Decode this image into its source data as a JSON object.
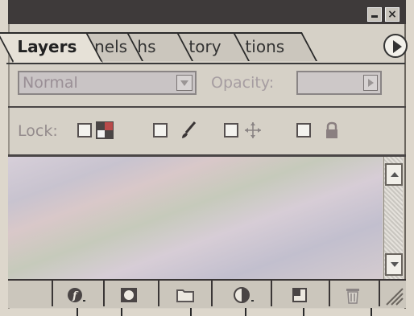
{
  "panel": {
    "tabs": [
      {
        "label": "Layers",
        "active": true
      },
      {
        "label": "nnels",
        "active": false
      },
      {
        "label": "hs",
        "active": false
      },
      {
        "label": "tory",
        "active": false
      },
      {
        "label": "tions",
        "active": false
      }
    ],
    "blend_mode": {
      "value": "Normal"
    },
    "opacity": {
      "label": "Opacity:",
      "value": ""
    },
    "lock": {
      "label": "Lock:",
      "options": [
        "lock-transparency",
        "lock-image",
        "lock-position",
        "lock-all"
      ]
    },
    "bottom_icons": [
      "layer-style-icon",
      "layer-mask-icon",
      "new-set-icon",
      "adjustment-layer-icon",
      "new-layer-icon",
      "trash-icon"
    ]
  },
  "colors": {
    "titlebar": "#3e3a3a",
    "panel_bg": "#d6d1c7",
    "active_tab": "#e6e1d7"
  }
}
